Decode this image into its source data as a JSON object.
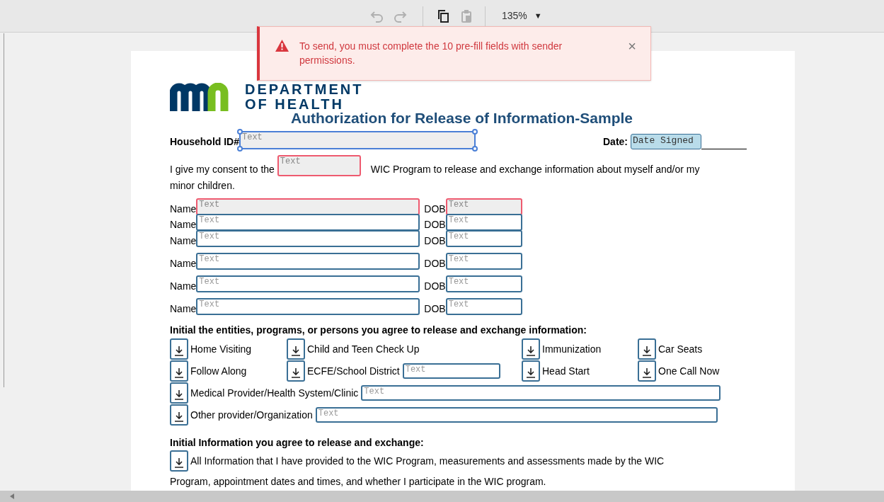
{
  "toolbar": {
    "zoom": "135%",
    "zoom_caret": "▼"
  },
  "toast": {
    "message": "To send, you must complete the 10 pre-fill fields with sender permissions.",
    "close": "×"
  },
  "logo": {
    "line_1": "DEPARTMENT",
    "line_2": "OF HEALTH"
  },
  "title": "Authorization for Release of Information-Sample",
  "household": {
    "label": "Household ID#",
    "field": {
      "placeholder": "Text",
      "error": false,
      "selected": true
    }
  },
  "date": {
    "label": "Date:",
    "field": {
      "placeholder": "Date Signed",
      "error": false,
      "selected": false
    }
  },
  "consent": {
    "before": "I give my consent to the",
    "field": {
      "placeholder": "Text",
      "error": true,
      "selected": false
    },
    "after": "WIC Program to release and exchange information about myself and/or my",
    "continuation": "minor children."
  },
  "people": [
    {
      "name_label": "Name",
      "name_field": {
        "placeholder": "Text",
        "error": true,
        "selected": false
      },
      "dob_label": "DOB",
      "dob_field": {
        "placeholder": "Text",
        "error": true,
        "selected": false
      }
    },
    {
      "name_label": "Name",
      "name_field": {
        "placeholder": "Text",
        "error": false,
        "selected": false
      },
      "dob_label": "DOB",
      "dob_field": {
        "placeholder": "Text",
        "error": false,
        "selected": false
      }
    },
    {
      "name_label": "Name",
      "name_field": {
        "placeholder": "Text",
        "error": false,
        "selected": false
      },
      "dob_label": "DOB",
      "dob_field": {
        "placeholder": "Text",
        "error": false,
        "selected": false
      }
    },
    {
      "name_label": "Name",
      "name_field": {
        "placeholder": "Text",
        "error": false,
        "selected": false
      },
      "dob_label": "DOB",
      "dob_field": {
        "placeholder": "Text",
        "error": false,
        "selected": false
      }
    },
    {
      "name_label": "Name",
      "name_field": {
        "placeholder": "Text",
        "error": false,
        "selected": false
      },
      "dob_label": "DOB",
      "dob_field": {
        "placeholder": "Text",
        "error": false,
        "selected": false
      }
    },
    {
      "name_label": "Name",
      "name_field": {
        "placeholder": "Text",
        "error": false,
        "selected": false
      },
      "dob_label": "DOB",
      "dob_field": {
        "placeholder": "Text",
        "error": false,
        "selected": false
      }
    }
  ],
  "entities_heading": "Initial the entities, programs, or persons you agree to release and exchange information:",
  "entity_rows": [
    [
      {
        "label": "Home Visiting"
      },
      {
        "label": "Child and Teen Check Up"
      },
      {
        "label": "Immunization"
      },
      {
        "label": "Car Seats"
      }
    ],
    [
      {
        "label": "Follow Along"
      },
      {
        "label": "ECFE/School District",
        "field": {
          "placeholder": "Text",
          "error": false,
          "selected": false
        }
      },
      {
        "label": "Head Start"
      },
      {
        "label": "One Call Now"
      }
    ],
    [
      {
        "label": "Medical Provider/Health System/Clinic",
        "field": {
          "placeholder": "Text",
          "error": false,
          "selected": false
        }
      }
    ],
    [
      {
        "label": "Other provider/Organization",
        "field": {
          "placeholder": "Text",
          "error": false,
          "selected": false
        }
      }
    ]
  ],
  "info_heading": "Initial Information you agree to release and exchange:",
  "info_items": [
    {
      "label": "All Information that I have provided to the WIC Program, measurements and assessments made by the WIC",
      "continuation": "Program, appointment dates and times, and whether I participate in the WIC program."
    }
  ]
}
